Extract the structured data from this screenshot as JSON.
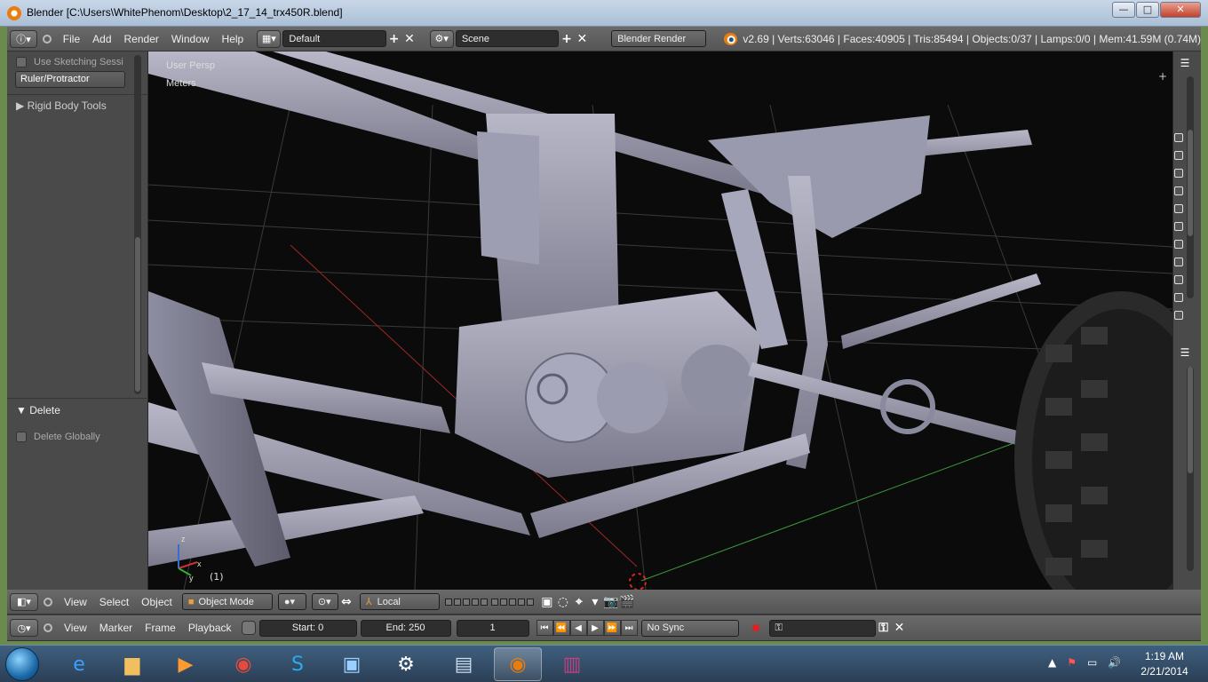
{
  "window": {
    "title": "Blender [C:\\Users\\WhitePhenom\\Desktop\\2_17_14_trx450R.blend]",
    "minimize": "—",
    "maximize": "□",
    "close": "✕"
  },
  "info_header": {
    "menus": [
      "File",
      "Add",
      "Render",
      "Window",
      "Help"
    ],
    "layout": "Default",
    "scene": "Scene",
    "render_engine": "Blender Render",
    "stats": "v2.69 | Verts:63046 | Faces:40905 | Tris:85494 | Objects:0/37 | Lamps:0/0 | Mem:41.59M (0.74M)"
  },
  "tool_shelf": {
    "use_sketching": "Use Sketching Sessi",
    "ruler": "Ruler/Protractor",
    "rigid_body": "Rigid Body Tools",
    "delete_panel": "Delete",
    "delete_globally": "Delete Globally"
  },
  "viewport": {
    "view_name": "User Persp",
    "units": "Meters",
    "frame": "(1)",
    "axes": {
      "x": "x",
      "y": "y",
      "z": "z"
    }
  },
  "view3d_header": {
    "menus": [
      "View",
      "Select",
      "Object"
    ],
    "mode": "Object Mode",
    "pivot": "Local"
  },
  "timeline_header": {
    "menus": [
      "View",
      "Marker",
      "Frame",
      "Playback"
    ],
    "start": "Start: 0",
    "end": "End: 250",
    "current": "1",
    "sync": "No Sync"
  },
  "taskbar": {
    "time": "1:19 AM",
    "date": "2/21/2014"
  },
  "colors": {
    "blender_orange": "#e87d0d",
    "mesh": "#9b9bb0",
    "grid": "#3a3a3a",
    "axis_x": "#a02828",
    "axis_y": "#3c9a3c"
  }
}
